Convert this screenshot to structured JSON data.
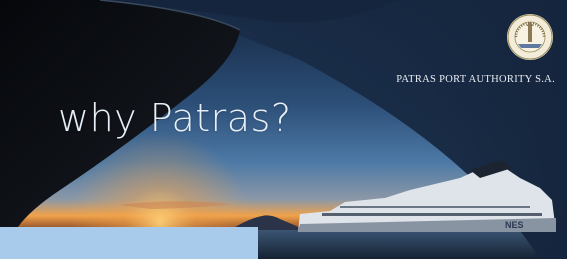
{
  "banner": {
    "headline": "why Patras?",
    "org_name": "PATRAS PORT AUTHORITY S.A."
  },
  "colors": {
    "sky_top": "#15253f",
    "sky_mid": "#3d6a99",
    "sunset": "#f0a24a",
    "sea": "#1c2c44",
    "bottom_bar": "#a9cbeb",
    "text": "#e6eef7"
  },
  "icons": {
    "seal": "port-authority-seal-icon",
    "ferry": "ferry-ship-illustration",
    "hull": "ship-hull-bow-shape"
  }
}
